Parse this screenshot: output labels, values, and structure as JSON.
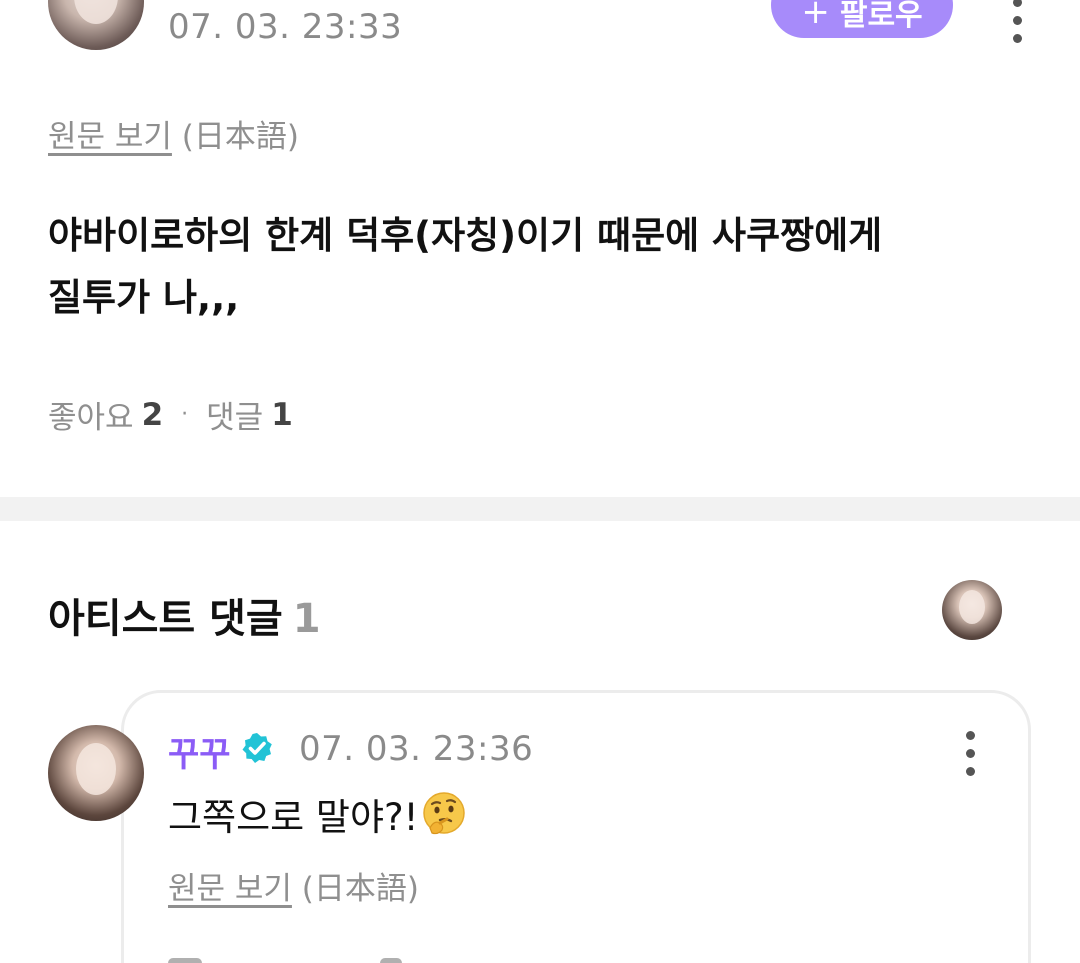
{
  "post": {
    "time": "07. 03. 23:33",
    "follow_label": "팔로우",
    "follow_icon": "plus-icon",
    "translate_link": "원문 보기",
    "translate_lang": "(日本語)",
    "body_line1": "야바이로하의 한계 덕후(자칭)이기 때문에 사쿠짱에게",
    "body_line2": "질투가 나,,,",
    "likes_label": "좋아요",
    "likes_count": "2",
    "comments_label": "댓글",
    "comments_count": "1",
    "separator": "·"
  },
  "artist_section": {
    "title": "아티스트 댓글",
    "count": "1"
  },
  "comment": {
    "author": "꾸꾸",
    "verified_icon": "verified-badge-icon",
    "time": "07. 03. 23:36",
    "text": "그쪽으로 말야?!",
    "emoji_icon": "thinking-face-icon",
    "translate_link": "원문 보기",
    "translate_lang": "(日本語)"
  },
  "colors": {
    "accent": "#a78bfa",
    "author": "#8b5cf6",
    "verified": "#22c3d6",
    "muted_text": "#8f8f8f"
  }
}
